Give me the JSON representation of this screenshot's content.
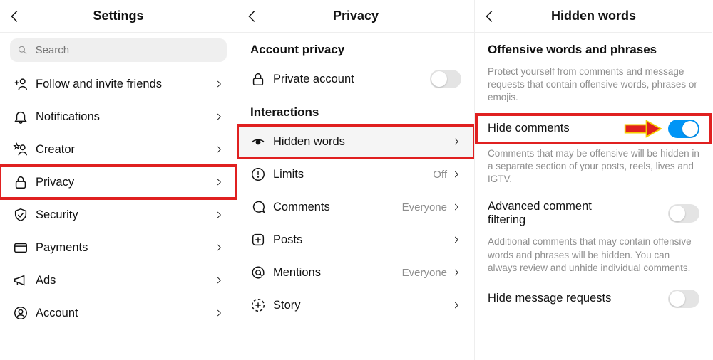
{
  "panel1": {
    "title": "Settings",
    "search_placeholder": "Search",
    "items": [
      {
        "label": "Follow and invite friends"
      },
      {
        "label": "Notifications"
      },
      {
        "label": "Creator"
      },
      {
        "label": "Privacy"
      },
      {
        "label": "Security"
      },
      {
        "label": "Payments"
      },
      {
        "label": "Ads"
      },
      {
        "label": "Account"
      }
    ]
  },
  "panel2": {
    "title": "Privacy",
    "section1": "Account privacy",
    "private_account": "Private account",
    "section2": "Interactions",
    "items": [
      {
        "label": "Hidden words",
        "value": ""
      },
      {
        "label": "Limits",
        "value": "Off"
      },
      {
        "label": "Comments",
        "value": "Everyone"
      },
      {
        "label": "Posts",
        "value": ""
      },
      {
        "label": "Mentions",
        "value": "Everyone"
      },
      {
        "label": "Story",
        "value": ""
      }
    ]
  },
  "panel3": {
    "title": "Hidden words",
    "section": "Offensive words and phrases",
    "desc1": "Protect yourself from comments and message requests that contain offensive words, phrases or emojis.",
    "row1_label": "Hide comments",
    "desc2": "Comments that may be offensive will be hidden in a separate section of your posts, reels, lives and IGTV.",
    "row2_label": "Advanced comment filtering",
    "desc3": "Additional comments that may contain offensive words and phrases will be hidden. You can always review and unhide individual comments.",
    "row3_label": "Hide message requests"
  }
}
